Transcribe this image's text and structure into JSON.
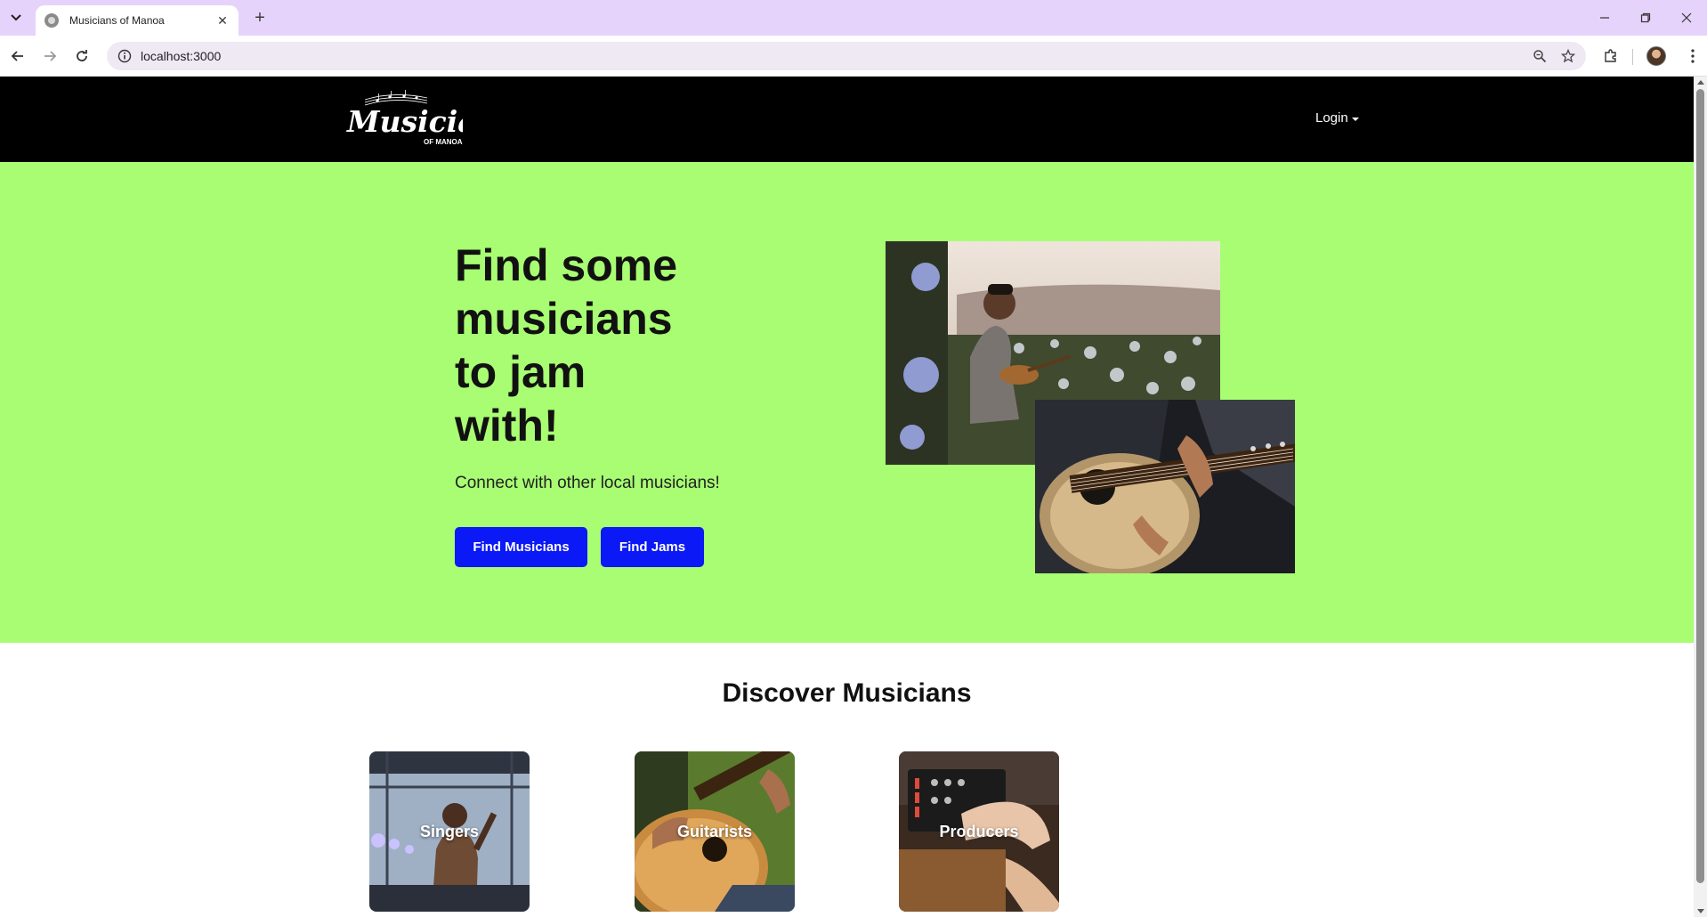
{
  "browser": {
    "tab_title": "Musicians of Manoa",
    "tab_close": "✕",
    "new_tab": "+",
    "url": "localhost:3000"
  },
  "site": {
    "logo_text": "Musicians",
    "logo_sub": "OF MANOA",
    "login_label": "Login"
  },
  "hero": {
    "title_lines": [
      "Find some",
      "musicians",
      "to jam",
      "with!"
    ],
    "subtitle": "Connect with other local musicians!",
    "find_musicians_label": "Find Musicians",
    "find_jams_label": "Find Jams"
  },
  "discover": {
    "title": "Discover Musicians",
    "categories": [
      {
        "label": "Singers"
      },
      {
        "label": "Guitarists"
      },
      {
        "label": "Producers"
      }
    ]
  },
  "colors": {
    "hero_bg": "#a8fd72",
    "nav_bg": "#000000",
    "button": "#0a19f5"
  }
}
